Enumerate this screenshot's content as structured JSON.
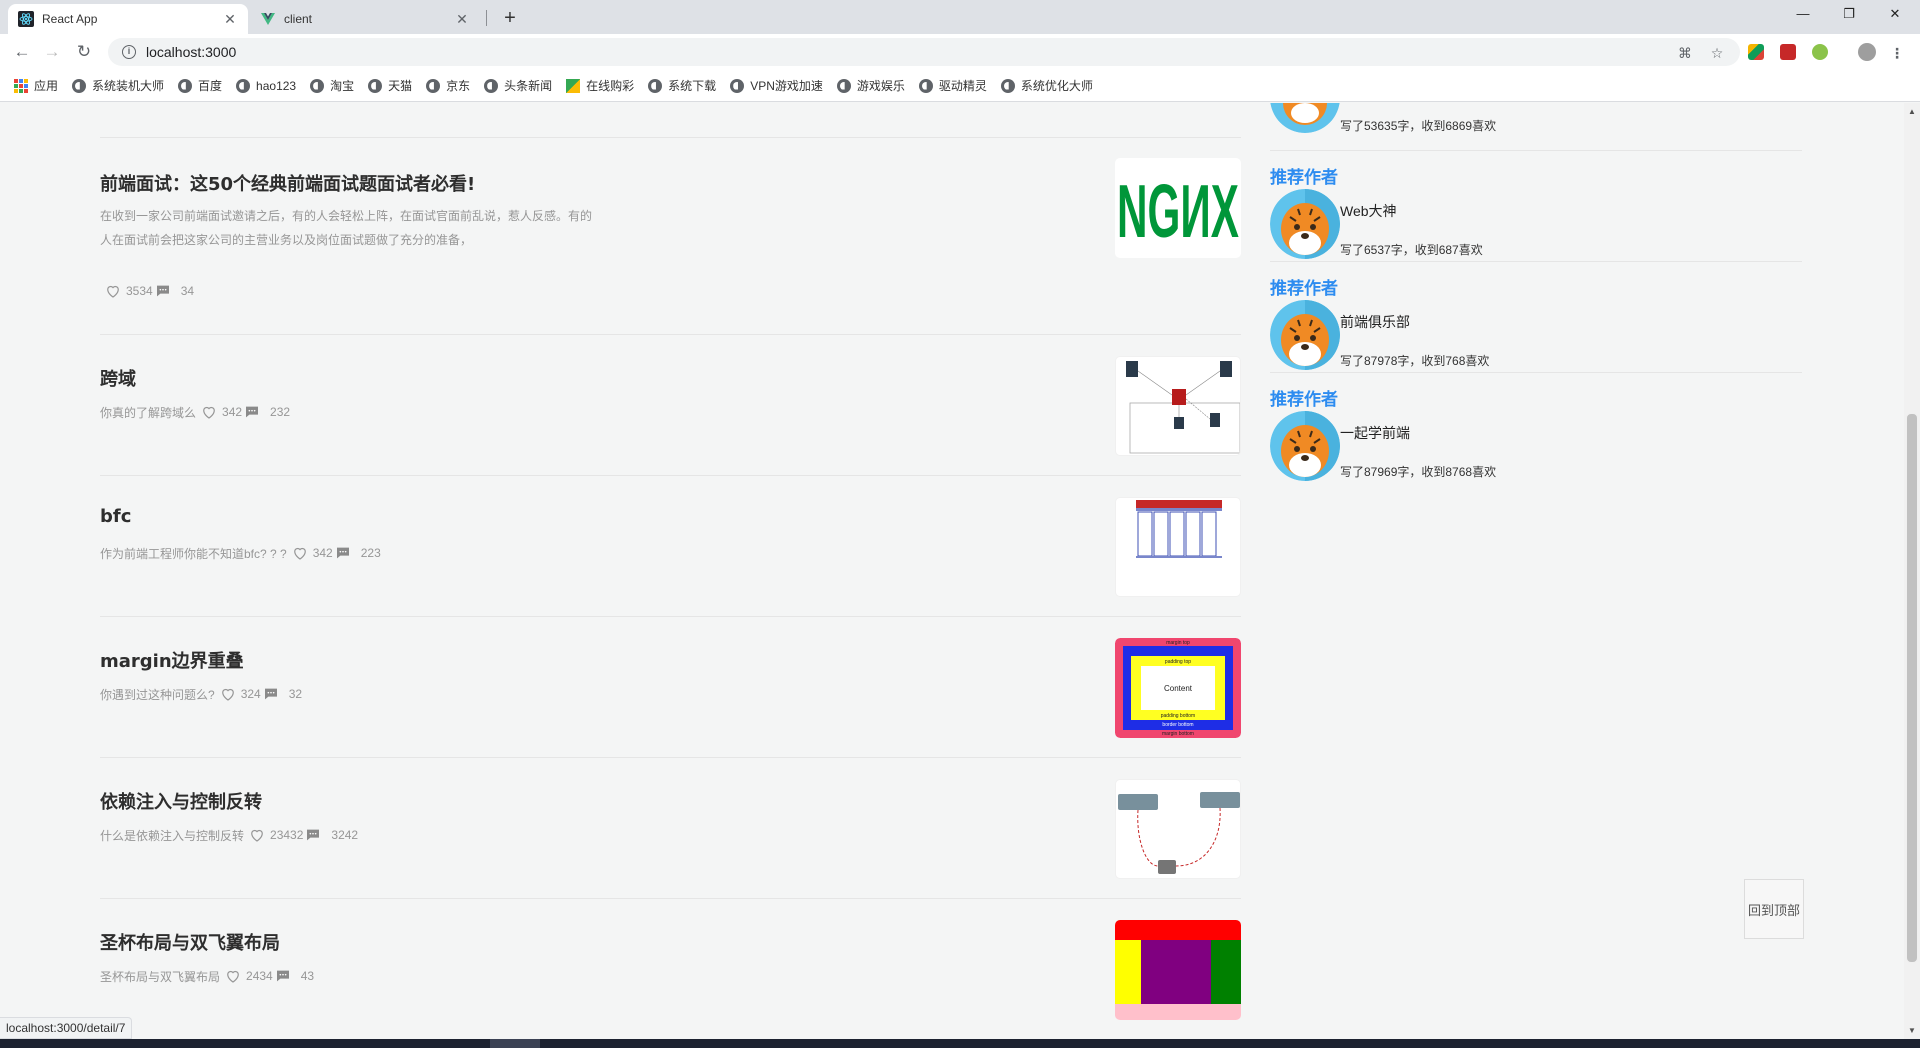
{
  "browser": {
    "tabs": [
      {
        "title": "React App",
        "active": true
      },
      {
        "title": "client",
        "active": false
      }
    ],
    "address": "localhost:3000",
    "bookmarks": [
      "应用",
      "系统装机大师",
      "百度",
      "hao123",
      "淘宝",
      "天猫",
      "京东",
      "头条新闻",
      "在线购彩",
      "系统下载",
      "VPN游戏加速",
      "游戏娱乐",
      "驱动精灵",
      "系统优化大师"
    ],
    "status_url": "localhost:3000/detail/7"
  },
  "articles": [
    {
      "title": "前端面试：这50个经典前端面试题面试者必看!",
      "desc": "在收到一家公司前端面试邀请之后，有的人会轻松上阵，在面试官面前乱说，惹人反感。有的人在面试前会把这家公司的主营业务以及岗位面试题做了充分的准备，",
      "likes": "3534",
      "comments": "34",
      "thumb": "nginx",
      "thumb_text": "NGИX"
    },
    {
      "title": "跨域",
      "desc": "你真的了解跨域么",
      "likes": "342",
      "comments": "232",
      "thumb": "network"
    },
    {
      "title": "bfc",
      "desc": "作为前端工程师你能不知道bfc? ? ?",
      "likes": "342",
      "comments": "223",
      "thumb": "bfc"
    },
    {
      "title": "margin边界重叠",
      "desc": "你遇到过这种问题么?",
      "likes": "324",
      "comments": "32",
      "thumb": "boxmodel",
      "thumb_labels": [
        "margin top",
        "padding top",
        "Content",
        "padding bottom",
        "border bottom",
        "margin bottom"
      ]
    },
    {
      "title": "依赖注入与控制反转",
      "desc": "什么是依赖注入与控制反转",
      "likes": "23432",
      "comments": "3242",
      "thumb": "di"
    },
    {
      "title": "圣杯布局与双飞翼布局",
      "desc": "圣杯布局与双飞翼布局",
      "likes": "2434",
      "comments": "43",
      "thumb": "layout"
    }
  ],
  "authors": [
    {
      "heading": "",
      "name": "",
      "stat": "写了53635字，收到6869喜欢"
    },
    {
      "heading": "推荐作者",
      "name": "Web大神",
      "stat": "写了6537字，收到687喜欢"
    },
    {
      "heading": "推荐作者",
      "name": "前端俱乐部",
      "stat": "写了87978字，收到768喜欢"
    },
    {
      "heading": "推荐作者",
      "name": "一起学前端",
      "stat": "写了87969字，收到8768喜欢"
    }
  ],
  "back_to_top": "回到顶部",
  "colors": {
    "accent": "#2d8cf0",
    "meta_gray": "#969696",
    "title": "#2e2e2e"
  }
}
